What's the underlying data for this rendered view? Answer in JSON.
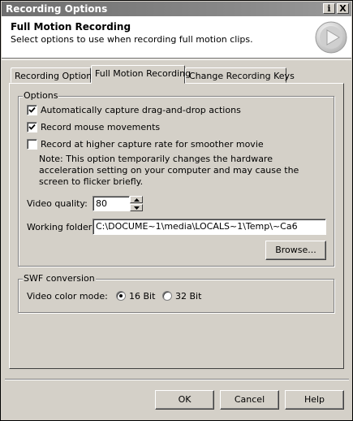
{
  "window": {
    "title": "Recording Options",
    "help_glyph": "i",
    "close_glyph": "X"
  },
  "header": {
    "title": "Full Motion Recording",
    "subtitle": "Select options to use when recording full motion clips.",
    "logo_icon": "play-circle-icon"
  },
  "tabs": [
    {
      "label": "Recording Options",
      "active": false
    },
    {
      "label": "Full Motion Recording",
      "active": true
    },
    {
      "label": "Change Recording Keys",
      "active": false
    }
  ],
  "options_group": {
    "legend": "Options",
    "checkboxes": [
      {
        "label": "Automatically capture drag-and-drop actions",
        "checked": true
      },
      {
        "label": "Record mouse movements",
        "checked": true
      },
      {
        "label": "Record at higher capture rate for smoother movie",
        "checked": false
      }
    ],
    "note": "Note: This option temporarily changes the hardware acceleration setting on your computer and may cause the screen to flicker briefly.",
    "video_quality_label": "Video quality:",
    "video_quality_value": "80",
    "working_folder_label": "Working folder:",
    "working_folder_value": "C:\\DOCUME~1\\media\\LOCALS~1\\Temp\\~Ca6",
    "browse_label": "Browse..."
  },
  "swf_group": {
    "legend": "SWF conversion",
    "color_mode_label": "Video color mode:",
    "options": [
      {
        "label": "16 Bit",
        "selected": true
      },
      {
        "label": "32 Bit",
        "selected": false
      }
    ]
  },
  "buttons": {
    "ok": "OK",
    "cancel": "Cancel",
    "help": "Help"
  }
}
